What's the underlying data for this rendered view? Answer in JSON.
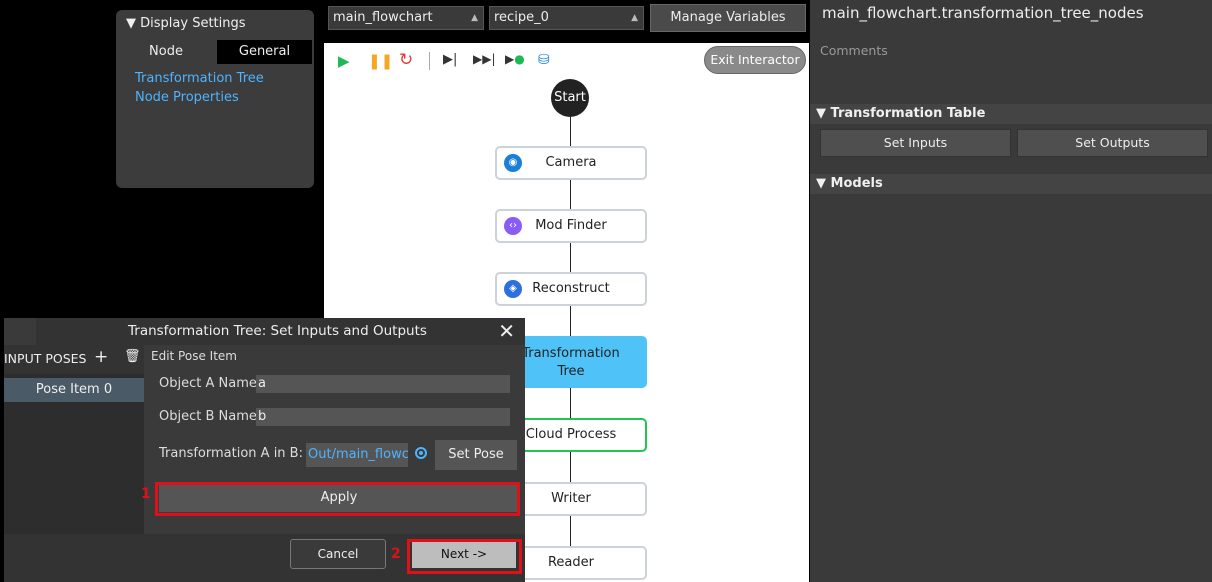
{
  "display_settings": {
    "header": "Display Settings",
    "tabs": [
      "Node",
      "General"
    ],
    "links": [
      "Transformation Tree",
      "Node Properties"
    ]
  },
  "topbar": {
    "flowchart_select": "main_flowchart",
    "recipe_select": "recipe_0",
    "manage_variables": "Manage Variables"
  },
  "toolbar": {
    "icons": [
      "play-icon",
      "pause-icon",
      "reload-icon",
      "step-icon",
      "fast-forward-icon",
      "run-to-icon",
      "node-debug-icon"
    ],
    "exit_interactor": "Exit Interactor"
  },
  "flowchart": {
    "start": "Start",
    "nodes": [
      {
        "label": "Camera",
        "icon": "camera-icon",
        "color": "#1a7fd6"
      },
      {
        "label": "Mod Finder",
        "icon": "code-icon",
        "color": "#8a5cf6"
      },
      {
        "label": "Reconstruct",
        "icon": "cube-icon",
        "color": "#2b6fe0"
      },
      {
        "label": "Transformation Tree",
        "icon": "",
        "color": "#4fc3f7"
      },
      {
        "label": "Cloud Process",
        "icon": "",
        "color": "#23c552"
      },
      {
        "label": "Writer",
        "icon": "",
        "color": ""
      },
      {
        "label": "Reader",
        "icon": "",
        "color": ""
      }
    ]
  },
  "right_panel": {
    "title": "main_flowchart.transformation_tree_nodes",
    "comments": "Comments",
    "transformation_table": "Transformation Table",
    "set_inputs": "Set Inputs",
    "set_outputs": "Set Outputs",
    "models": "Models"
  },
  "dialog": {
    "title": "Transformation Tree: Set Inputs and Outputs",
    "input_poses": "INPUT POSES",
    "pose_item": "Pose Item 0",
    "edit_title": "Edit Pose Item",
    "object_a_label": "Object A Name:",
    "object_a_value": "a",
    "object_b_label": "Object B Name:",
    "object_b_value": "b",
    "transform_label": "Transformation A in B:",
    "transform_value": "Out/main_flowcha",
    "set_pose": "Set Pose",
    "apply": "Apply",
    "cancel": "Cancel",
    "next": "Next ->"
  },
  "annotations": {
    "step1": "1",
    "step2": "2",
    "highlight_color": "#e0101a"
  }
}
